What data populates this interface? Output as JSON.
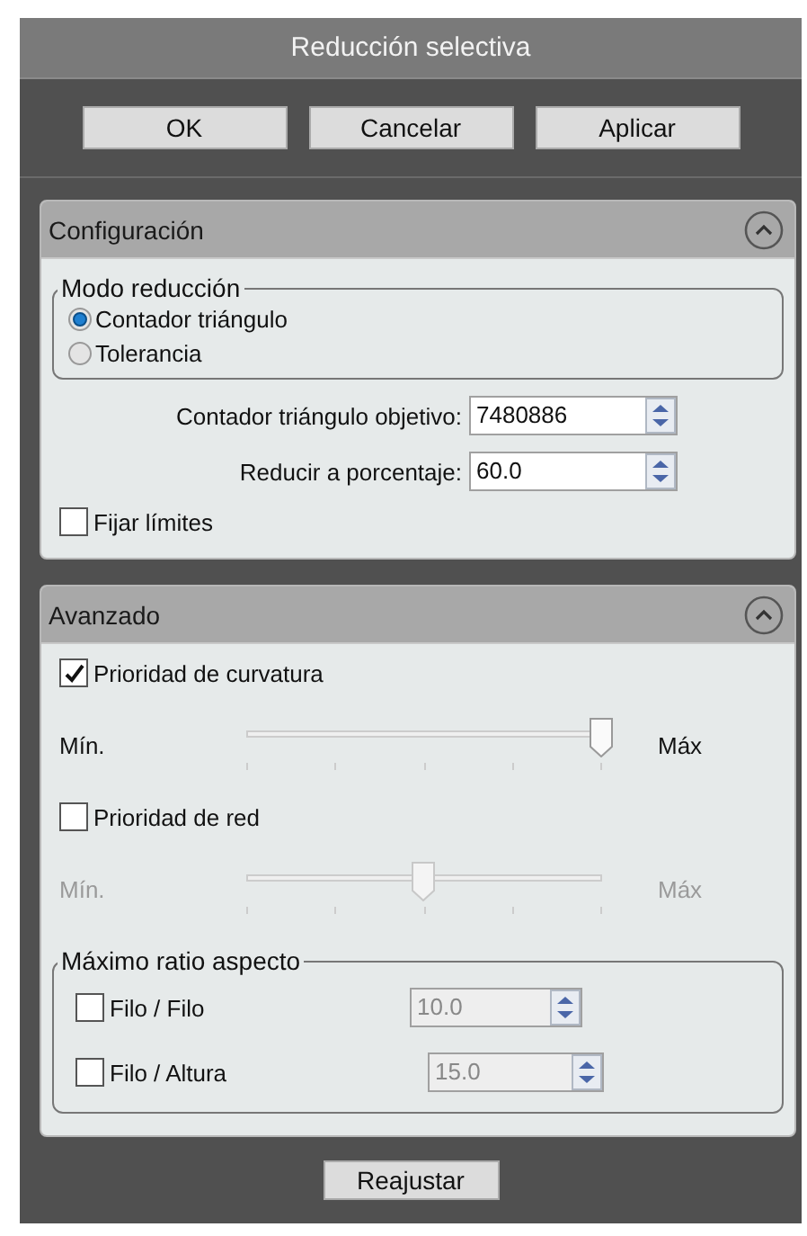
{
  "window": {
    "title": "Reducción selectiva"
  },
  "buttons": [
    {
      "label": "OK"
    },
    {
      "label": "Cancelar"
    },
    {
      "label": "Aplicar"
    }
  ],
  "sections": [
    {
      "title": "Configuración",
      "expanded": true,
      "items": [
        {
          "kind": "radio-group",
          "title": "Modo reducción",
          "options": [
            {
              "label": "Contador triángulo",
              "selected": true
            },
            {
              "label": "Tolerancia",
              "selected": false
            }
          ]
        },
        {
          "kind": "spin-field",
          "label": "Contador triángulo objetivo:",
          "value": "7480886",
          "disabled": false
        },
        {
          "kind": "spin-field",
          "label": "Reducir a porcentaje:",
          "value": "60.0",
          "disabled": false
        },
        {
          "kind": "checkbox",
          "label": "Fijar límites",
          "checked": false
        }
      ]
    },
    {
      "title": "Avanzado",
      "expanded": true,
      "items": [
        {
          "kind": "checkbox",
          "label": "Prioridad de curvatura",
          "checked": true
        },
        {
          "kind": "slider",
          "min_label": "Mín.",
          "max_label": "Máx",
          "level": 1.0,
          "disabled": false
        },
        {
          "kind": "checkbox",
          "label": "Prioridad de red",
          "checked": false
        },
        {
          "kind": "slider",
          "min_label": "Mín.",
          "max_label": "Máx",
          "level": 0.5,
          "disabled": true
        },
        {
          "kind": "check-group",
          "title": "Máximo ratio aspecto",
          "rows": [
            {
              "label": "Filo / Filo",
              "checked": false,
              "value": "10.0",
              "disabled": true
            },
            {
              "label": "Filo / Altura",
              "checked": false,
              "value": "15.0",
              "disabled": true
            }
          ]
        }
      ]
    }
  ],
  "footer_button": {
    "label": "Reajustar"
  }
}
